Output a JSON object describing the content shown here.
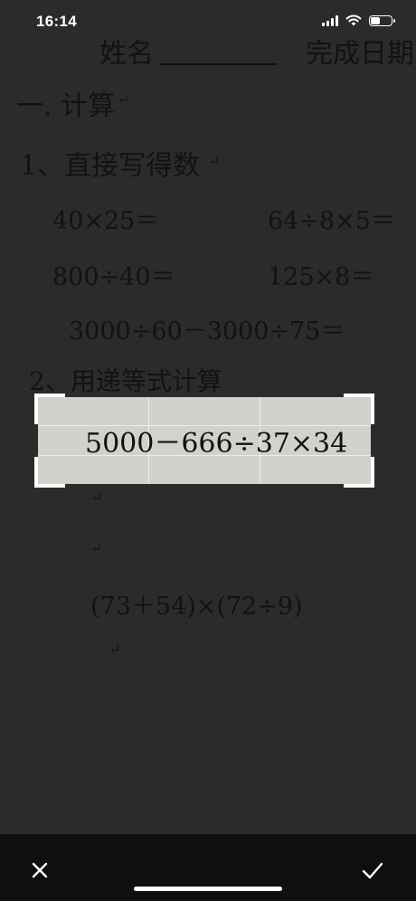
{
  "status_bar": {
    "time": "16:14",
    "signal_icon": "signal-bars-icon",
    "wifi_icon": "wifi-icon",
    "battery_icon": "battery-icon"
  },
  "worksheet": {
    "name_label": "姓名",
    "date_label": "完成日期",
    "section_one": "一. 计算",
    "subsection_one": "1、直接写得数",
    "problems": {
      "p1": "40×25＝",
      "p2": "64÷8×5＝",
      "p3": "800÷40＝",
      "p4": "125×8＝",
      "p5": "3000÷60－3000÷75＝"
    },
    "subsection_two": "2、用递等式计算",
    "problem_bottom": "(73＋54)×(72÷9)",
    "return_mark": "↵"
  },
  "crop": {
    "selected_text": "5000－666÷37×34"
  },
  "toolbar": {
    "close_icon": "close-icon",
    "confirm_icon": "checkmark-icon"
  },
  "colors": {
    "background": "#1e1e1e",
    "toolbar": "#0f0f0f",
    "crop_frame": "#ffffff",
    "crop_fill": "#d2d2cc"
  }
}
